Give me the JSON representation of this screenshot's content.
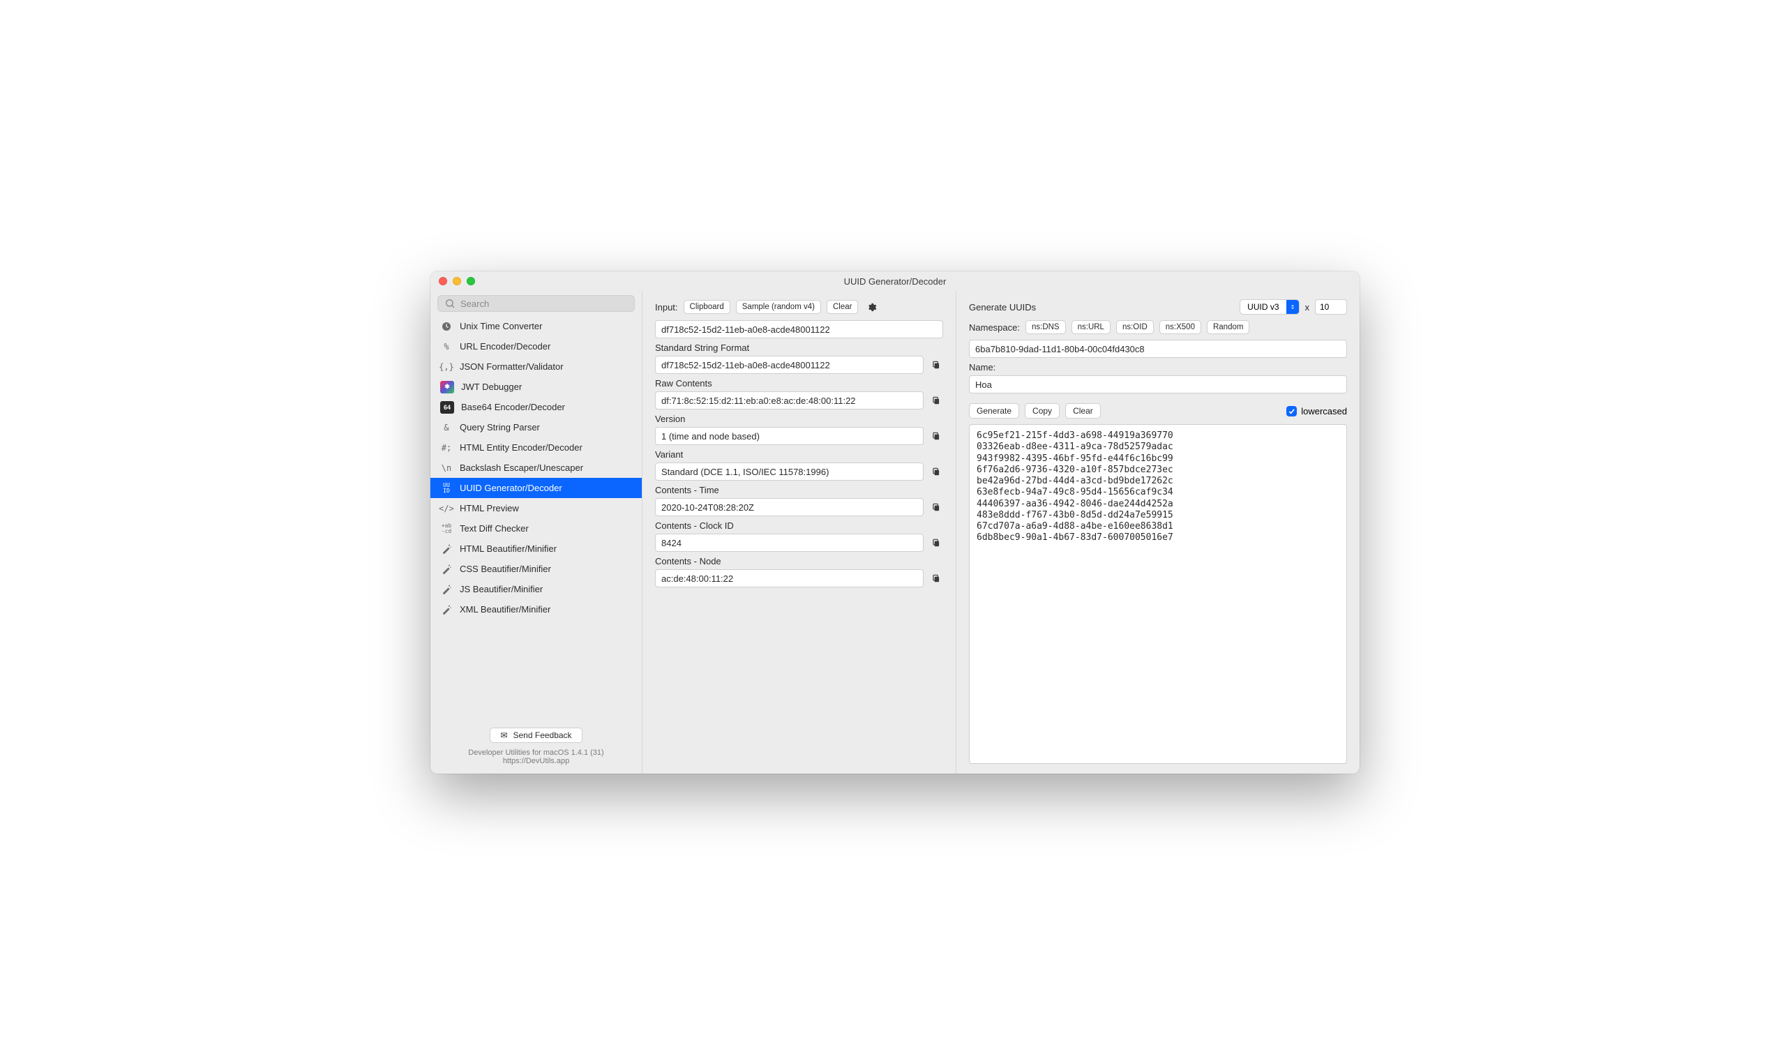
{
  "window": {
    "title": "UUID Generator/Decoder"
  },
  "search": {
    "placeholder": "Search"
  },
  "sidebar": {
    "items": [
      {
        "label": "Unix Time Converter"
      },
      {
        "label": "URL Encoder/Decoder"
      },
      {
        "label": "JSON Formatter/Validator"
      },
      {
        "label": "JWT Debugger"
      },
      {
        "label": "Base64 Encoder/Decoder"
      },
      {
        "label": "Query String Parser"
      },
      {
        "label": "HTML Entity Encoder/Decoder"
      },
      {
        "label": "Backslash Escaper/Unescaper"
      },
      {
        "label": "UUID Generator/Decoder"
      },
      {
        "label": "HTML Preview"
      },
      {
        "label": "Text Diff Checker"
      },
      {
        "label": "HTML Beautifier/Minifier"
      },
      {
        "label": "CSS Beautifier/Minifier"
      },
      {
        "label": "JS Beautifier/Minifier"
      },
      {
        "label": "XML Beautifier/Minifier"
      }
    ],
    "feedback": "Send Feedback",
    "footer_line1": "Developer Utilities for macOS 1.4.1 (31)",
    "footer_line2": "https://DevUtils.app"
  },
  "decoder": {
    "input_label": "Input:",
    "clipboard": "Clipboard",
    "sample": "Sample (random v4)",
    "clear": "Clear",
    "input_value": "df718c52-15d2-11eb-a0e8-acde48001122",
    "fields": [
      {
        "label": "Standard String Format",
        "value": "df718c52-15d2-11eb-a0e8-acde48001122"
      },
      {
        "label": "Raw Contents",
        "value": "df:71:8c:52:15:d2:11:eb:a0:e8:ac:de:48:00:11:22"
      },
      {
        "label": "Version",
        "value": "1 (time and node based)"
      },
      {
        "label": "Variant",
        "value": "Standard (DCE 1.1, ISO/IEC 11578:1996)"
      },
      {
        "label": "Contents - Time",
        "value": "2020-10-24T08:28:20Z"
      },
      {
        "label": "Contents - Clock ID",
        "value": "8424"
      },
      {
        "label": "Contents - Node",
        "value": "ac:de:48:00:11:22"
      }
    ]
  },
  "generator": {
    "title": "Generate UUIDs",
    "type": "UUID v3",
    "x": "x",
    "count": "10",
    "namespace_label": "Namespace:",
    "namespace_presets": [
      "ns:DNS",
      "ns:URL",
      "ns:OID",
      "ns:X500",
      "Random"
    ],
    "namespace_value": "6ba7b810-9dad-11d1-80b4-00c04fd430c8",
    "name_label": "Name:",
    "name_value": "Hoa",
    "generate": "Generate",
    "copy": "Copy",
    "clear": "Clear",
    "lowercased": "lowercased",
    "output": "6c95ef21-215f-4dd3-a698-44919a369770\n03326eab-d8ee-4311-a9ca-78d52579adac\n943f9982-4395-46bf-95fd-e44f6c16bc99\n6f76a2d6-9736-4320-a10f-857bdce273ec\nbe42a96d-27bd-44d4-a3cd-bd9bde17262c\n63e8fecb-94a7-49c8-95d4-15656caf9c34\n44406397-aa36-4942-8046-dae244d4252a\n483e8ddd-f767-43b0-8d5d-dd24a7e59915\n67cd707a-a6a9-4d88-a4be-e160ee8638d1\n6db8bec9-90a1-4b67-83d7-6007005016e7"
  }
}
